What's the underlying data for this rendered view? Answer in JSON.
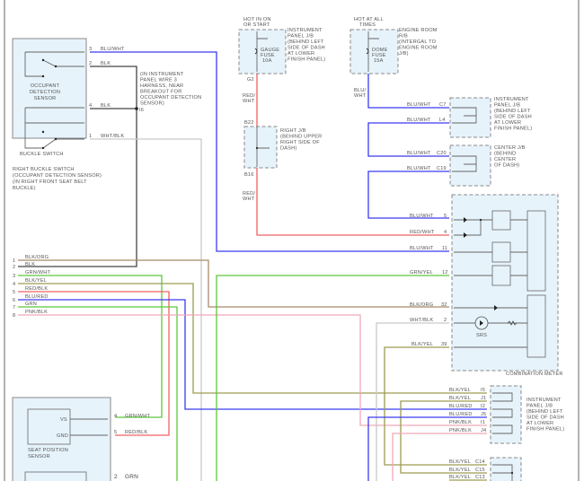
{
  "colors": {
    "BLU": "#3b3bf0",
    "RED": "#f06060",
    "GRN": "#5cc83c",
    "OLIVE": "#9c9c50",
    "BROWN": "#a88a68",
    "GRAY": "#c9c9c9",
    "PINK": "#f0a8b8",
    "BLK": "#444444",
    "box_fill": "#e6f3fb"
  },
  "buckle_switch": {
    "pins": [
      "3",
      "2",
      "4",
      "1"
    ],
    "wires": [
      "BLU/WHT",
      "BLK",
      "BLK",
      "WHT/BLK"
    ],
    "occupant_label": [
      "OCCUPANT",
      "DETECTION",
      "SENSOR"
    ],
    "buckle_label": "BUCKLE SWITCH",
    "component_label": [
      "RIGHT BUCKLE SWITCH",
      "(OCCUPANT DETECTION SENSOR)",
      "(IN RIGHT FRONT SEAT BELT",
      "BUCKLE)"
    ]
  },
  "splice": {
    "note": [
      "(IN INSTRUMENT",
      "PANEL WIRE 3",
      "HARNESS, NEAR",
      "BREAKOUT FOR",
      "OCCUPANT DETECTION",
      "SENSOR)"
    ],
    "id": "I6"
  },
  "left_connector": {
    "rows": [
      {
        "pin": "1",
        "wire": "BLK/ORG"
      },
      {
        "pin": "2",
        "wire": "BLK"
      },
      {
        "pin": "3",
        "wire": "GRN/WHT"
      },
      {
        "pin": "4",
        "wire": "BLK/YEL"
      },
      {
        "pin": "5",
        "wire": "RED/BLK"
      },
      {
        "pin": "6",
        "wire": "BLU/RED"
      },
      {
        "pin": "7",
        "wire": "GRN"
      },
      {
        "pin": "8",
        "wire": "PNK/BLK"
      }
    ]
  },
  "gauge_fuse": {
    "hot": [
      "HOT IN ON",
      "OR START"
    ],
    "fuse": [
      "GAUGE",
      "FUSE",
      "10A"
    ],
    "location": [
      "INSTRUMENT",
      "PANEL J/B",
      "(BEHIND LEFT",
      "SIDE OF DASH",
      "AT LOWER",
      "FINISH PANEL)"
    ],
    "out_pin": "G2",
    "wire": [
      "RED/",
      "WHT"
    ]
  },
  "right_jb": {
    "in_pin": "B22",
    "out_pin": "B16",
    "location": [
      "RIGHT J/B",
      "(BEHIND UPPER",
      "RIGHT SIDE OF",
      "DASH)"
    ],
    "wire": [
      "RED/",
      "WHT"
    ]
  },
  "dome_fuse": {
    "hot": [
      "HOT AT ALL",
      "TIMES"
    ],
    "fuse": [
      "DOME",
      "FUSE",
      "15A"
    ],
    "location": [
      "ENGINE ROOM",
      "R/B",
      "(INTERGAL TO",
      "ENGINE ROOM",
      "J/B)"
    ],
    "wire": [
      "BLU/",
      "WHT"
    ]
  },
  "ip_jb_top": {
    "rows": [
      {
        "wire": "BLU/WHT",
        "pin": "C7"
      },
      {
        "wire": "BLU/WHT",
        "pin": "L4"
      }
    ],
    "location": [
      "INSTRUMENT",
      "PANEL J/B",
      "(BEHIND LEFT",
      "SIDE OF DASH",
      "AT LOWER",
      "FINISH PANEL)"
    ]
  },
  "center_jb": {
    "rows": [
      {
        "wire": "BLU/WHT",
        "pin": "C20"
      },
      {
        "wire": "BLU/WHT",
        "pin": "C19"
      }
    ],
    "location": [
      "CENTER J/B",
      "(BEHIND",
      "CENTER",
      "OF DASH)"
    ]
  },
  "combination_meter": {
    "rows": [
      {
        "wire": "BLU/WHT",
        "pin": "5"
      },
      {
        "wire": "RED/WHT",
        "pin": "4"
      },
      {
        "wire": "BLU/WHT",
        "pin": "11"
      },
      {
        "wire": "GRN/YEL",
        "pin": "12"
      },
      {
        "wire": "BLK/ORG",
        "pin": "32"
      },
      {
        "wire": "WHT/BLK",
        "pin": "2"
      },
      {
        "wire": "BLK/YEL",
        "pin": "39"
      }
    ],
    "srs_label": "SRS",
    "title": "COMBINATION METER"
  },
  "ip_jb_bottom": {
    "rows": [
      {
        "wire": "BLK/YEL",
        "pin": "I5"
      },
      {
        "wire": "BLK/YEL",
        "pin": "J1"
      },
      {
        "wire": "BLU/RED",
        "pin": "I2"
      },
      {
        "wire": "BLU/RED",
        "pin": "J5"
      },
      {
        "wire": "PNK/BLK",
        "pin": "I1"
      },
      {
        "wire": "PNK/BLK",
        "pin": "J4"
      }
    ],
    "location": [
      "INSTRUMENT",
      "PANEL J/B",
      "(BEHIND LEFT",
      "SIDE OF DASH",
      "AT LOWER",
      "FINISH PANEL)"
    ]
  },
  "bottom_jb": {
    "rows": [
      {
        "wire": "BLK/YEL",
        "pin": "C14"
      },
      {
        "wire": "BLK/YEL",
        "pin": "C15"
      },
      {
        "wire": "BLK/YEL",
        "pin": "C13"
      }
    ]
  },
  "seat_position_sensor": {
    "terminals": [
      "VS",
      "GND"
    ],
    "pins": [
      {
        "pin": "4",
        "wire": "GRN/WHT"
      },
      {
        "pin": "5",
        "wire": "RED/BLK"
      }
    ],
    "label": [
      "SEAT POSITION",
      "SENSOR"
    ],
    "lower_pin": {
      "pin": "2",
      "wire": "GRN"
    }
  }
}
